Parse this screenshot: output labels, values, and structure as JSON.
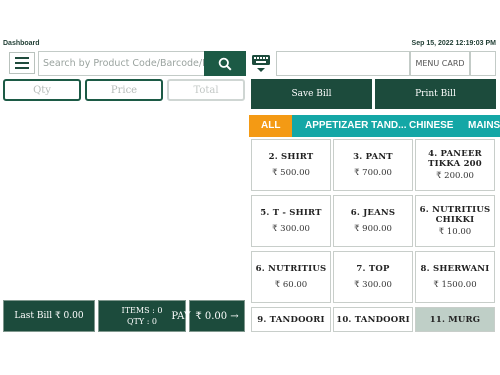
{
  "header": {
    "title": "Dashboard",
    "datetime": "Sep 15, 2022 12:19:03 PM"
  },
  "search": {
    "placeholder": "Search by Product Code/Barcode/Name",
    "search_icon": "search-icon"
  },
  "menu_card": {
    "label": "MENU CARD",
    "value": ""
  },
  "cart_headers": {
    "qty": "Qty",
    "price": "Price",
    "total": "Total"
  },
  "actions": {
    "save_bill": "Save Bill",
    "print_bill": "Print Bill"
  },
  "categories": [
    "ALL",
    "APPETIZAER TAND...",
    "CHINESE",
    "MAINS"
  ],
  "products": [
    {
      "name": "2. SHIRT",
      "price": "₹ 500.00"
    },
    {
      "name": "3. PANT",
      "price": "₹ 700.00"
    },
    {
      "name": "4. PANEER TIKKA 200",
      "price": "₹ 200.00"
    },
    {
      "name": "5. T - SHIRT",
      "price": "₹ 300.00"
    },
    {
      "name": "6. JEANS",
      "price": "₹ 900.00"
    },
    {
      "name": "6. NUTRITIUS CHIKKI",
      "price": "₹ 10.00"
    },
    {
      "name": "6. NUTRITIUS",
      "price": "₹ 60.00"
    },
    {
      "name": "7. TOP",
      "price": "₹ 300.00"
    },
    {
      "name": "8. SHERWANI",
      "price": "₹ 1500.00"
    },
    {
      "name": "9. TANDOORI",
      "price": ""
    },
    {
      "name": "10. TANDOORI",
      "price": ""
    },
    {
      "name": "11. MURG",
      "price": ""
    }
  ],
  "footer": {
    "last_bill": "Last Bill ₹ 0.00",
    "items": "ITEMS : 0",
    "qty": "QTY : 0",
    "pay_label": "PAY",
    "pay_amount": "₹ 0.00 →"
  },
  "colors": {
    "primary": "#1c4b3c",
    "tab_bar": "#14a7a6",
    "tab_active": "#f49a14"
  }
}
